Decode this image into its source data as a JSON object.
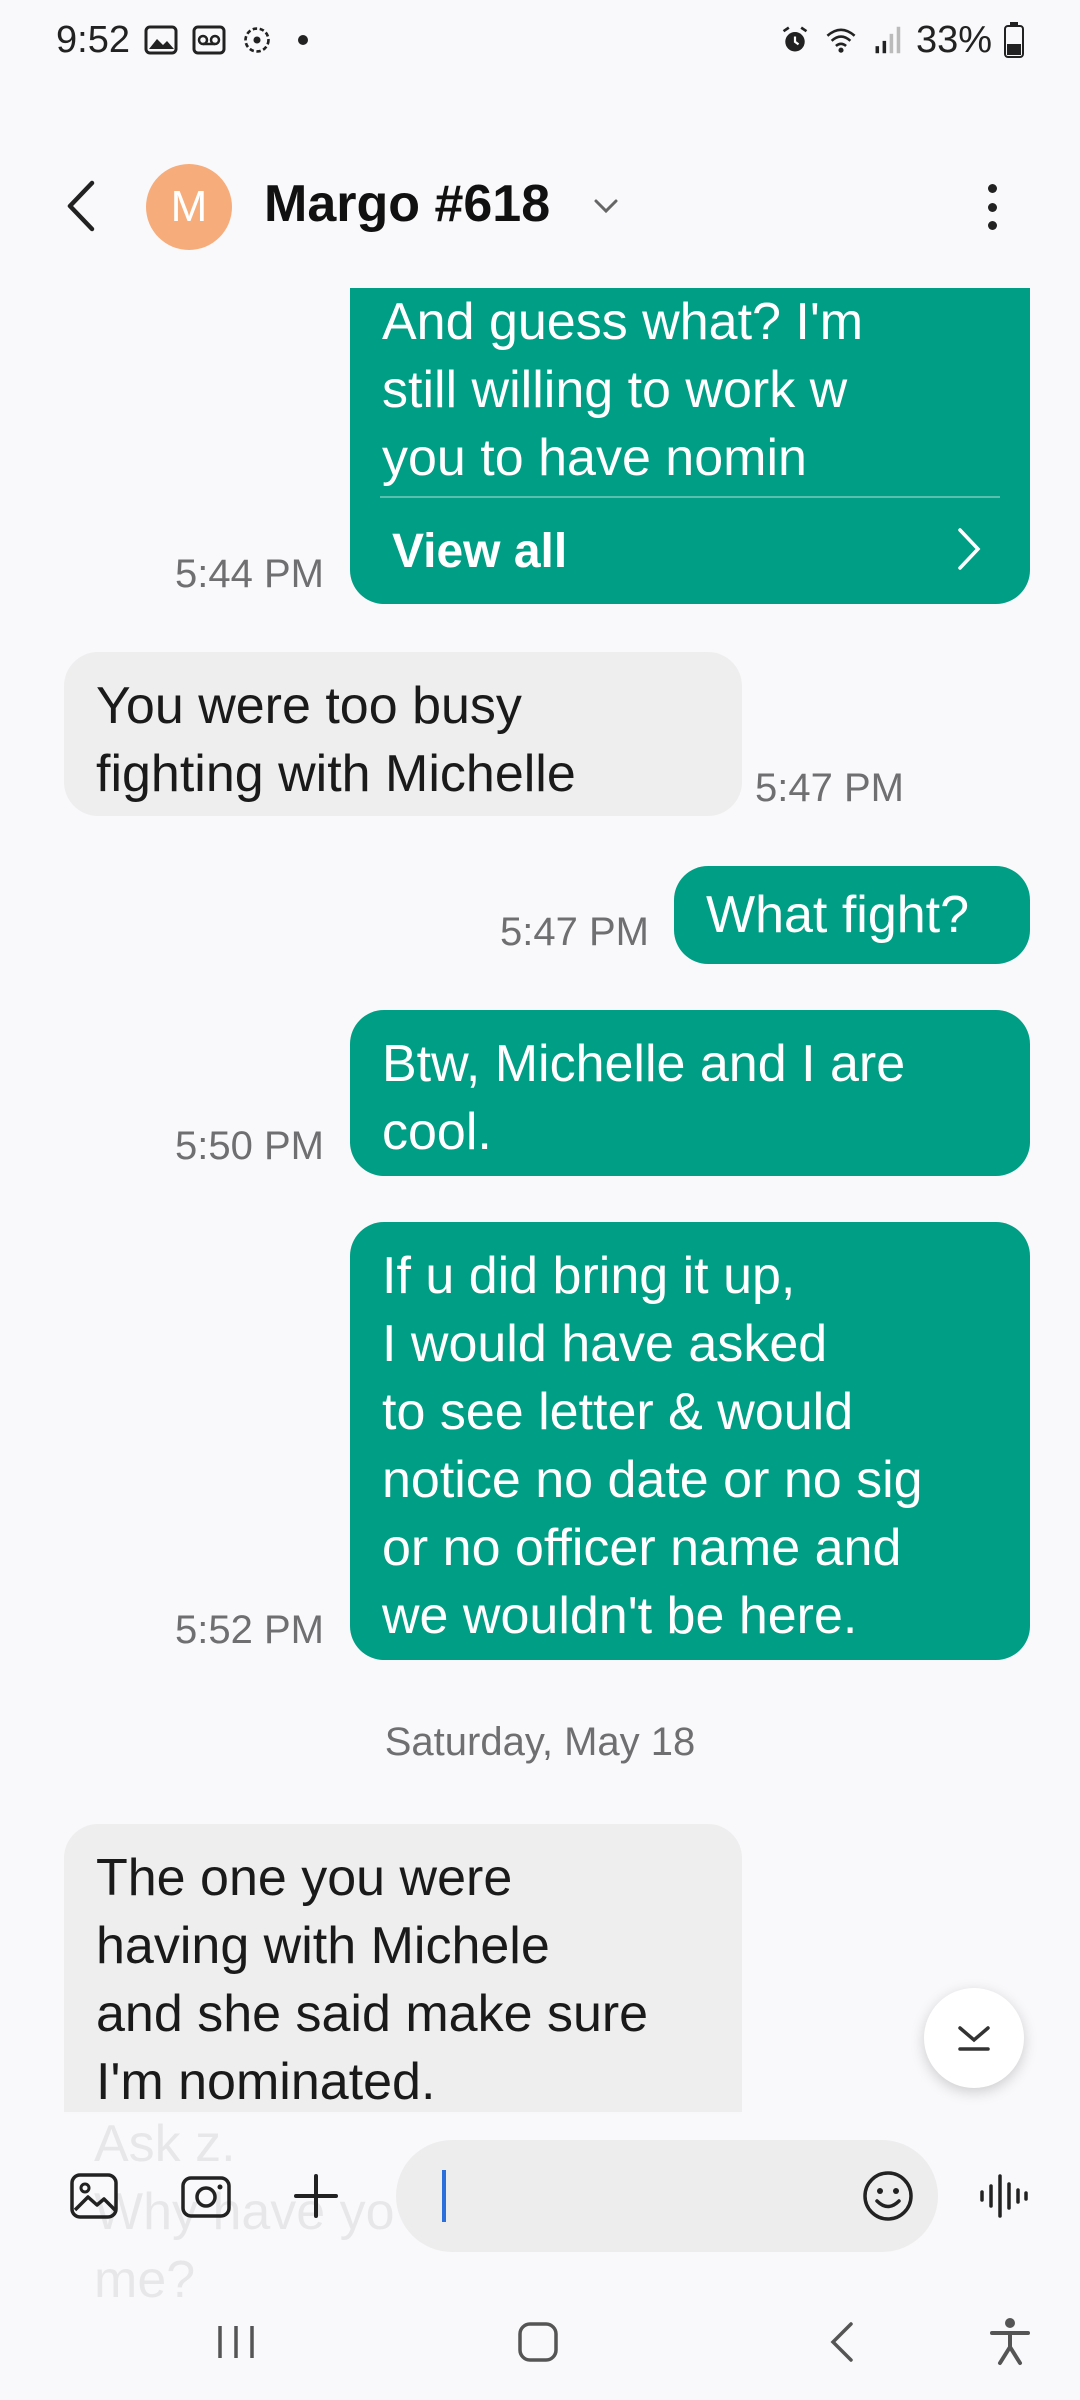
{
  "status_bar": {
    "time": "9:52",
    "battery": "33%",
    "icons": [
      "gallery-icon",
      "voicemail-icon",
      "sync-icon",
      "dot-icon",
      "alarm-icon",
      "wifi-icon",
      "signal-icon",
      "battery-icon"
    ]
  },
  "header": {
    "avatar_letter": "M",
    "avatar_color": "#f6ad7b",
    "contact_name": "Margo #618"
  },
  "messages": {
    "m1": {
      "lines": [
        "And guess what? I'm",
        "still willing to work w",
        "you to have nomin"
      ],
      "view_all": "View all",
      "time": "5:44 PM"
    },
    "m2": {
      "lines": [
        "You were too busy",
        "fighting with Michelle"
      ],
      "time": "5:47 PM"
    },
    "m3": {
      "lines": [
        "What fight?"
      ],
      "time": "5:47 PM"
    },
    "m4": {
      "lines": [
        "Btw, Michelle and I are",
        "cool."
      ],
      "time": "5:50 PM"
    },
    "m5": {
      "lines": [
        "If u did bring it up,",
        "I would have asked",
        "to see letter & would",
        "notice no date or no sig",
        "or no officer name and",
        "we wouldn't be here."
      ],
      "time": "5:52 PM"
    },
    "date_separator": "Saturday, May 18",
    "m6": {
      "lines": [
        "The one you were",
        "having with Michele",
        "and she said make sure",
        "I'm nominated."
      ]
    },
    "ghost_lines": [
      "Ask z.",
      "Why have yo",
      "me?"
    ]
  },
  "composer": {
    "input_value": "",
    "input_placeholder": ""
  },
  "colors": {
    "outgoing_bubble": "#009e84",
    "incoming_bubble": "#eeeeef",
    "background": "#f9f9fb"
  }
}
